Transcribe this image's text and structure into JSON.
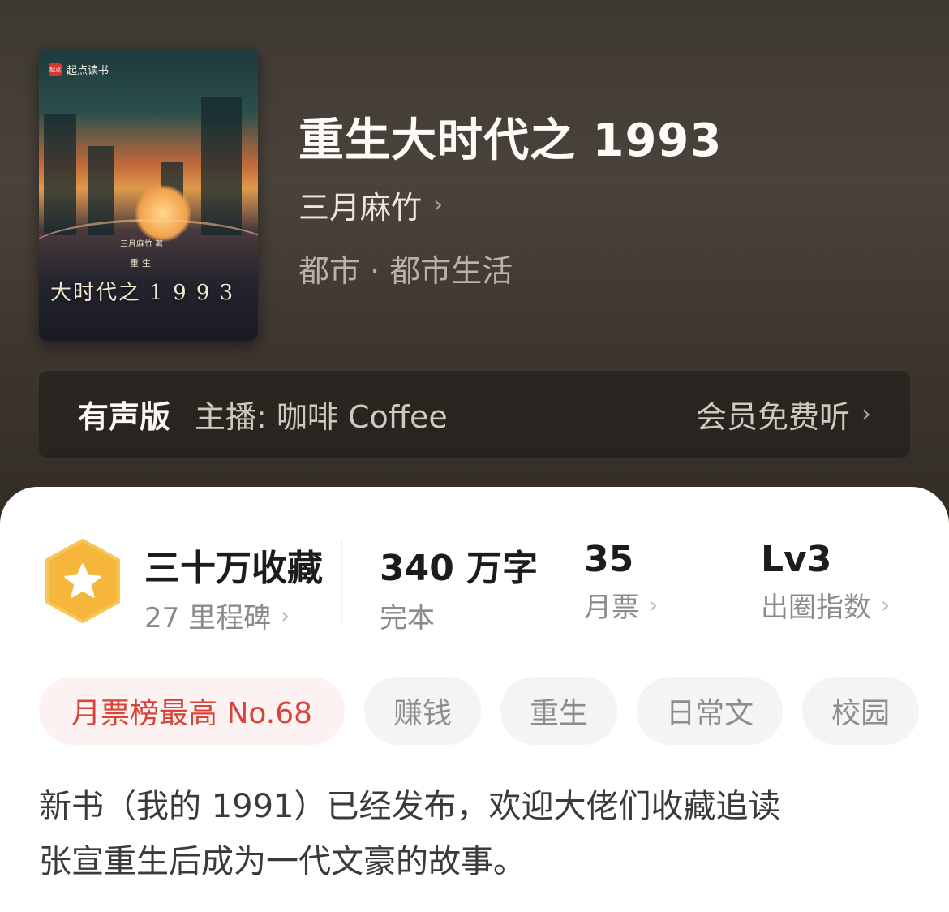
{
  "cover": {
    "brand": "起点读书",
    "brand_logo_text": "起点",
    "author_line": "三月麻竹 著",
    "tag": "重生",
    "title": "大时代之 1 9 9 3"
  },
  "book": {
    "title": "重生大时代之 1993",
    "author": "三月麻竹",
    "genre": "都市 · 都市生活"
  },
  "audio": {
    "badge": "有声版",
    "host": "主播:  咖啡 Coffee",
    "cta": "会员免费听"
  },
  "stats": {
    "favorites": {
      "value": "三十万收藏",
      "sub": "27 里程碑"
    },
    "words": {
      "value": "340 万字",
      "sub": "完本"
    },
    "tickets": {
      "value": "35",
      "sub": "月票"
    },
    "influence": {
      "value": "Lv3",
      "sub": "出圈指数"
    }
  },
  "tags": [
    "月票榜最高 No.68",
    "赚钱",
    "重生",
    "日常文",
    "校园"
  ],
  "description": [
    "新书（我的 1991）已经发布，欢迎大佬们收藏追读",
    "张宣重生后成为一代文豪的故事。"
  ],
  "colors": {
    "accent_red": "#d9433a",
    "medal_gold": "#f5b63b"
  },
  "icons": {
    "chevron": "›",
    "medal": "star-hexagon-icon"
  }
}
